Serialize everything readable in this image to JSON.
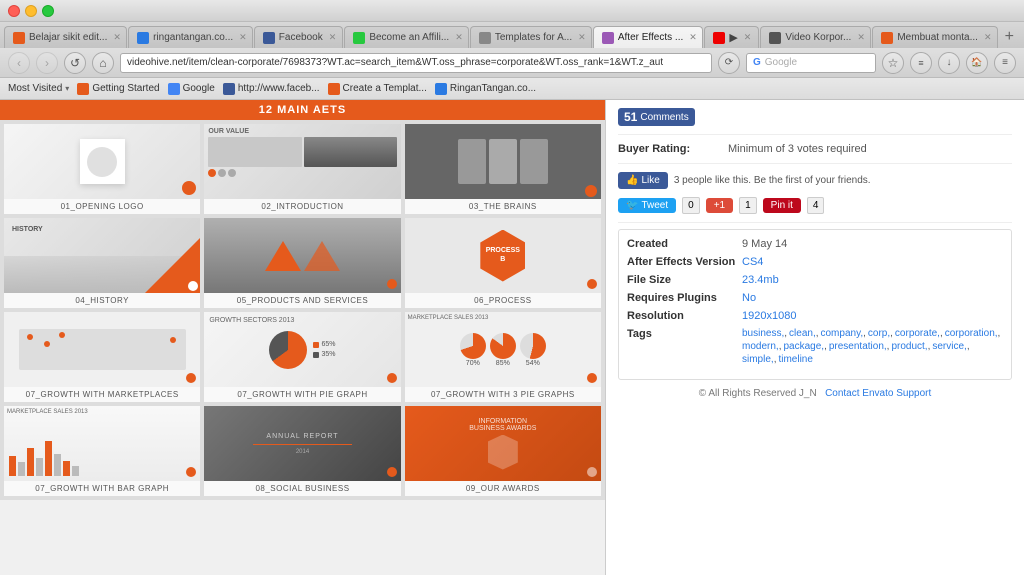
{
  "browser": {
    "tabs": [
      {
        "id": "belajar",
        "label": "Belajar sikit edit...",
        "fav_class": "fav-belajar",
        "active": false
      },
      {
        "id": "ringan",
        "label": "ringantangan.co...",
        "fav_class": "fav-ringan",
        "active": false
      },
      {
        "id": "facebook",
        "label": "Facebook",
        "fav_class": "fav-fb",
        "active": false
      },
      {
        "id": "become",
        "label": "Become an Affili...",
        "fav_class": "fav-become",
        "active": false
      },
      {
        "id": "templates",
        "label": "Templates for A...",
        "fav_class": "fav-templates",
        "active": false
      },
      {
        "id": "after-effects",
        "label": "After Effects ...",
        "fav_class": "fav-after",
        "active": true
      },
      {
        "id": "youtube",
        "label": "▶",
        "fav_class": "fav-yt",
        "active": false
      },
      {
        "id": "video-corp",
        "label": "Video Korpor...",
        "fav_class": "fav-video",
        "active": false
      },
      {
        "id": "membuat",
        "label": "Membuat monta...",
        "fav_class": "fav-membuat",
        "active": false
      }
    ],
    "address": "videohive.net/item/clean-corporate/7698373?WT.ac=search_item&WT.oss_phrase=corporate&WT.oss_rank=1&WT.z_aut",
    "search_placeholder": "Google",
    "bookmarks": [
      {
        "label": "Most Visited",
        "has_arrow": true
      },
      {
        "label": "Getting Started"
      },
      {
        "label": "Google"
      },
      {
        "label": "http://www.faceb..."
      },
      {
        "label": "Create a Templat..."
      },
      {
        "label": "RinganTangan.co..."
      }
    ]
  },
  "left_panel": {
    "header": "12 MAIN AETS",
    "grid_items": [
      {
        "id": "item-1",
        "label": "01_OPENING LOGO"
      },
      {
        "id": "item-2",
        "label": "02_INTRODUCTION"
      },
      {
        "id": "item-3",
        "label": "03_THE BRAINS"
      },
      {
        "id": "item-4",
        "label": "04_HISTORY"
      },
      {
        "id": "item-5",
        "label": "05_PRODUCTS AND SERVICES"
      },
      {
        "id": "item-6",
        "label": "06_PROCESS"
      },
      {
        "id": "item-7",
        "label": "07_GROWTH WITH MARKETPLACES"
      },
      {
        "id": "item-8",
        "label": "07_GROWTH WITH PIE GRAPH"
      },
      {
        "id": "item-9",
        "label": "07_GROWTH WITH 3 PIE GRAPHS"
      },
      {
        "id": "item-10",
        "label": "07_GROWTH WITH BAR GRAPH"
      },
      {
        "id": "item-11",
        "label": "08_SOCIAL BUSINESS"
      },
      {
        "id": "item-12",
        "label": "09_OUR AWARDS"
      }
    ]
  },
  "right_panel": {
    "comments_count": "51",
    "comments_label": "Comments",
    "buyer_rating_label": "Buyer Rating:",
    "buyer_rating_value": "Minimum of 3 votes required",
    "facebook_like_text": "3 people like this. Be the first of your friends.",
    "like_label": "Like",
    "tweet_label": "Tweet",
    "tweet_count": "0",
    "gplus_label": "+1",
    "gplus_count": "1",
    "pin_label": "Pin it",
    "pin_count": "4",
    "details": {
      "created_label": "Created",
      "created_value": "9 May 14",
      "version_label": "After Effects Version",
      "version_value": "CS4",
      "filesize_label": "File Size",
      "filesize_value": "23.4mb",
      "plugins_label": "Requires Plugins",
      "plugins_value": "No",
      "resolution_label": "Resolution",
      "resolution_value": "1920x1080",
      "tags_label": "Tags",
      "tags": [
        "business",
        "clean",
        "company",
        "corp",
        "corporate",
        "corporation",
        "modern",
        "package",
        "presentation",
        "product",
        "service",
        "simple",
        "timeline"
      ]
    },
    "footer": "© All Rights Reserved J_N",
    "contact_link": "Contact Envato Support"
  }
}
